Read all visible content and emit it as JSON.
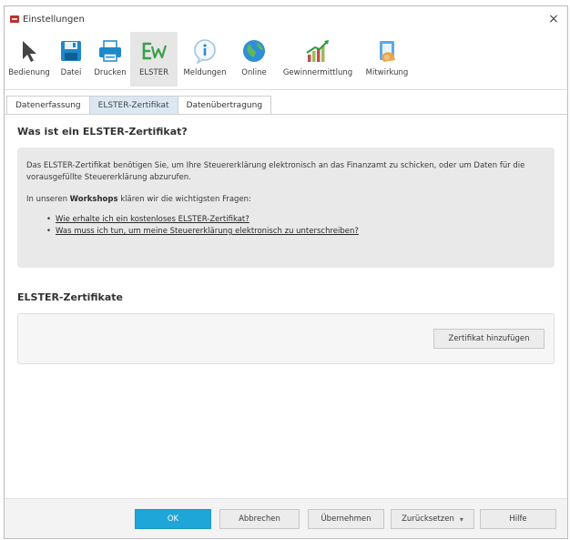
{
  "window": {
    "title": "Einstellungen",
    "close_symbol": "×"
  },
  "toolbar": {
    "items": [
      {
        "label": "Bedienung",
        "icon": "cursor-arrow-icon"
      },
      {
        "label": "Datei",
        "icon": "floppy-disk-icon"
      },
      {
        "label": "Drucken",
        "icon": "printer-icon"
      },
      {
        "label": "ELSTER",
        "icon": "elster-icon",
        "active": true
      },
      {
        "label": "Meldungen",
        "icon": "info-bubble-icon"
      },
      {
        "label": "Online",
        "icon": "globe-icon"
      },
      {
        "label": "Gewinnermittlung",
        "icon": "bar-chart-icon"
      },
      {
        "label": "Mitwirkung",
        "icon": "clipboard-hand-icon"
      }
    ]
  },
  "tabs": [
    {
      "label": "Datenerfassung",
      "active": false
    },
    {
      "label": "ELSTER-Zertifikat",
      "active": true
    },
    {
      "label": "Datenübertragung",
      "active": false
    }
  ],
  "main": {
    "heading": "Was ist ein ELSTER-Zertifikat?",
    "info": {
      "paragraph": "Das ELSTER-Zertifikat benötigen Sie, um Ihre Steuererklärung elektronisch an das Finanzamt zu schicken, oder um Daten für die vorausgefüllte Steuererklärung abzurufen.",
      "workshop_prefix": "In unseren ",
      "workshop_bold": "Workshops",
      "workshop_suffix": " klären wir die wichtigsten Fragen:",
      "links": [
        "Wie erhalte ich ein kostenloses ELSTER-Zertifikat?",
        "Was muss ich tun, um meine Steuererklärung elektronisch zu unterschreiben?"
      ]
    },
    "cert_heading": "ELSTER-Zertifikate",
    "add_cert_label": "Zertifikat hinzufügen"
  },
  "footer": {
    "ok": "OK",
    "cancel": "Abbrechen",
    "apply": "Übernehmen",
    "reset": "Zurücksetzen",
    "help": "Hilfe"
  },
  "colors": {
    "accent": "#1ea6d8",
    "tab_active": "#dbe8f3",
    "info_bg": "#e9e9e9"
  }
}
